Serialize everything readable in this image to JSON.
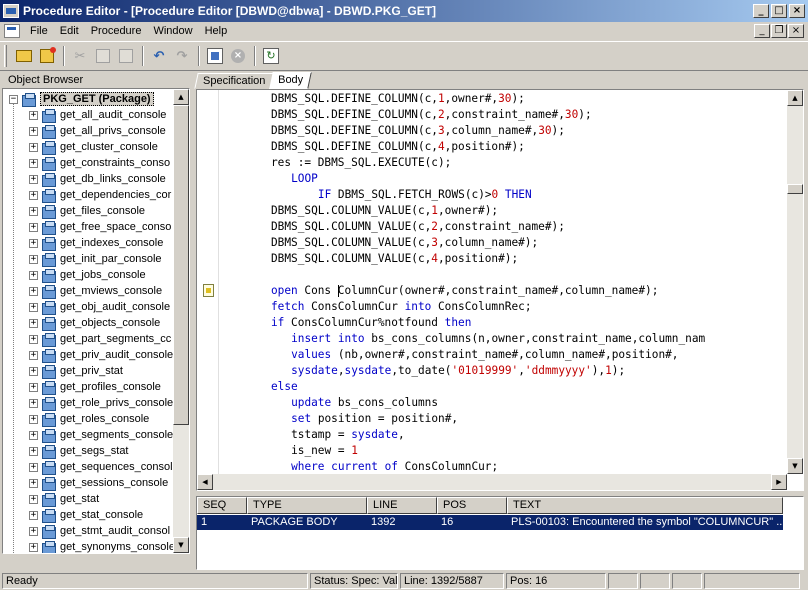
{
  "window": {
    "title": "Procedure Editor - [Procedure Editor [DBWD@dbwa] - DBWD.PKG_GET]"
  },
  "menu": {
    "items": [
      "File",
      "Edit",
      "Procedure",
      "Window",
      "Help"
    ]
  },
  "toolbar": {
    "icons": [
      "open-icon",
      "new-icon",
      "cut-icon",
      "copy-icon",
      "paste-icon",
      "undo-icon",
      "redo-icon",
      "compile-icon",
      "stop-icon",
      "refresh-icon"
    ]
  },
  "object_browser": {
    "header": "Object Browser",
    "root": "PKG_GET (Package)",
    "items": [
      "get_all_audit_console",
      "get_all_privs_console",
      "get_cluster_console",
      "get_constraints_conso",
      "get_db_links_console",
      "get_dependencies_cor",
      "get_files_console",
      "get_free_space_conso",
      "get_indexes_console",
      "get_init_par_console",
      "get_jobs_console",
      "get_mviews_console",
      "get_obj_audit_console",
      "get_objects_console",
      "get_part_segments_cc",
      "get_priv_audit_console",
      "get_priv_stat",
      "get_profiles_console",
      "get_role_privs_console",
      "get_roles_console",
      "get_segments_console",
      "get_segs_stat",
      "get_sequences_consol",
      "get_sessions_console",
      "get_stat",
      "get_stat_console",
      "get_stmt_audit_consol",
      "get_synonyms_console"
    ]
  },
  "tabs": {
    "specification": "Specification",
    "body": "Body"
  },
  "editor": {
    "lines": [
      {
        "indent": 0,
        "tokens": [
          [
            "t",
            "DBMS_SQL.DEFINE_COLUMN(c,"
          ],
          [
            "n",
            "1"
          ],
          [
            "t",
            ",owner#,"
          ],
          [
            "n",
            "30"
          ],
          [
            "t",
            ");"
          ]
        ]
      },
      {
        "indent": 0,
        "tokens": [
          [
            "t",
            "DBMS_SQL.DEFINE_COLUMN(c,"
          ],
          [
            "n",
            "2"
          ],
          [
            "t",
            ",constraint_name#,"
          ],
          [
            "n",
            "30"
          ],
          [
            "t",
            ");"
          ]
        ]
      },
      {
        "indent": 0,
        "tokens": [
          [
            "t",
            "DBMS_SQL.DEFINE_COLUMN(c,"
          ],
          [
            "n",
            "3"
          ],
          [
            "t",
            ",column_name#,"
          ],
          [
            "n",
            "30"
          ],
          [
            "t",
            ");"
          ]
        ]
      },
      {
        "indent": 0,
        "tokens": [
          [
            "t",
            "DBMS_SQL.DEFINE_COLUMN(c,"
          ],
          [
            "n",
            "4"
          ],
          [
            "t",
            ",position#);"
          ]
        ]
      },
      {
        "indent": 0,
        "tokens": [
          [
            "t",
            "res := DBMS_SQL.EXECUTE(c);"
          ]
        ]
      },
      {
        "indent": 3,
        "tokens": [
          [
            "k",
            "LOOP"
          ]
        ]
      },
      {
        "indent": 7,
        "tokens": [
          [
            "k",
            "IF"
          ],
          [
            "t",
            " DBMS_SQL.FETCH_ROWS(c)>"
          ],
          [
            "n",
            "0"
          ],
          [
            "t",
            " "
          ],
          [
            "k",
            "THEN"
          ]
        ]
      },
      {
        "indent": 0,
        "tokens": [
          [
            "t",
            "DBMS_SQL.COLUMN_VALUE(c,"
          ],
          [
            "n",
            "1"
          ],
          [
            "t",
            ",owner#);"
          ]
        ]
      },
      {
        "indent": 0,
        "tokens": [
          [
            "t",
            "DBMS_SQL.COLUMN_VALUE(c,"
          ],
          [
            "n",
            "2"
          ],
          [
            "t",
            ",constraint_name#);"
          ]
        ]
      },
      {
        "indent": 0,
        "tokens": [
          [
            "t",
            "DBMS_SQL.COLUMN_VALUE(c,"
          ],
          [
            "n",
            "3"
          ],
          [
            "t",
            ",column_name#);"
          ]
        ]
      },
      {
        "indent": 0,
        "tokens": [
          [
            "t",
            "DBMS_SQL.COLUMN_VALUE(c,"
          ],
          [
            "n",
            "4"
          ],
          [
            "t",
            ",position#);"
          ]
        ]
      },
      {
        "indent": 0,
        "tokens": []
      },
      {
        "indent": 0,
        "tokens": [
          [
            "k",
            "open"
          ],
          [
            "t",
            " Cons "
          ],
          [
            "c",
            ""
          ],
          [
            "t",
            "ColumnCur(owner#,constraint_name#,column_name#);"
          ]
        ]
      },
      {
        "indent": 0,
        "tokens": [
          [
            "k",
            "fetch"
          ],
          [
            "t",
            " ConsColumnCur "
          ],
          [
            "k",
            "into"
          ],
          [
            "t",
            " ConsColumnRec;"
          ]
        ]
      },
      {
        "indent": 0,
        "tokens": [
          [
            "k",
            "if"
          ],
          [
            "t",
            " ConsColumnCur%notfound "
          ],
          [
            "k",
            "then"
          ]
        ]
      },
      {
        "indent": 3,
        "tokens": [
          [
            "k",
            "insert into"
          ],
          [
            "t",
            " bs_cons_columns(n,owner,constraint_name,column_nam"
          ]
        ]
      },
      {
        "indent": 3,
        "tokens": [
          [
            "k",
            "values"
          ],
          [
            "t",
            " (nb,owner#,constraint_name#,column_name#,position#,"
          ]
        ]
      },
      {
        "indent": 3,
        "tokens": [
          [
            "k",
            "sysdate"
          ],
          [
            "t",
            ","
          ],
          [
            "k",
            "sysdate"
          ],
          [
            "t",
            ",to_date("
          ],
          [
            "s",
            "'01019999'"
          ],
          [
            "t",
            ","
          ],
          [
            "s",
            "'ddmmyyyy'"
          ],
          [
            "t",
            "),"
          ],
          [
            "n",
            "1"
          ],
          [
            "t",
            ");"
          ]
        ]
      },
      {
        "indent": 0,
        "tokens": [
          [
            "k",
            "else"
          ]
        ]
      },
      {
        "indent": 3,
        "tokens": [
          [
            "k",
            "update"
          ],
          [
            "t",
            " bs_cons_columns"
          ]
        ]
      },
      {
        "indent": 3,
        "tokens": [
          [
            "k",
            "set"
          ],
          [
            "t",
            " position = position#,"
          ]
        ]
      },
      {
        "indent": 3,
        "tokens": [
          [
            "t",
            "tstamp = "
          ],
          [
            "k",
            "sysdate"
          ],
          [
            "t",
            ","
          ]
        ]
      },
      {
        "indent": 3,
        "tokens": [
          [
            "t",
            "is_new = "
          ],
          [
            "n",
            "1"
          ]
        ]
      },
      {
        "indent": 3,
        "tokens": [
          [
            "k",
            "where current of"
          ],
          [
            "t",
            " ConsColumnCur;"
          ]
        ]
      }
    ]
  },
  "messages": {
    "columns": [
      "SEQ",
      "TYPE",
      "LINE",
      "POS",
      "TEXT"
    ],
    "rows": [
      {
        "seq": "1",
        "type": "PACKAGE BODY",
        "line": "1392",
        "pos": "16",
        "text": "PLS-00103: Encountered the symbol \"COLUMNCUR\" ..."
      }
    ]
  },
  "status": {
    "ready": "Ready",
    "status_label": "Status:  Spec: Val",
    "line": "Line: 1392/5887",
    "pos": "Pos: 16"
  }
}
